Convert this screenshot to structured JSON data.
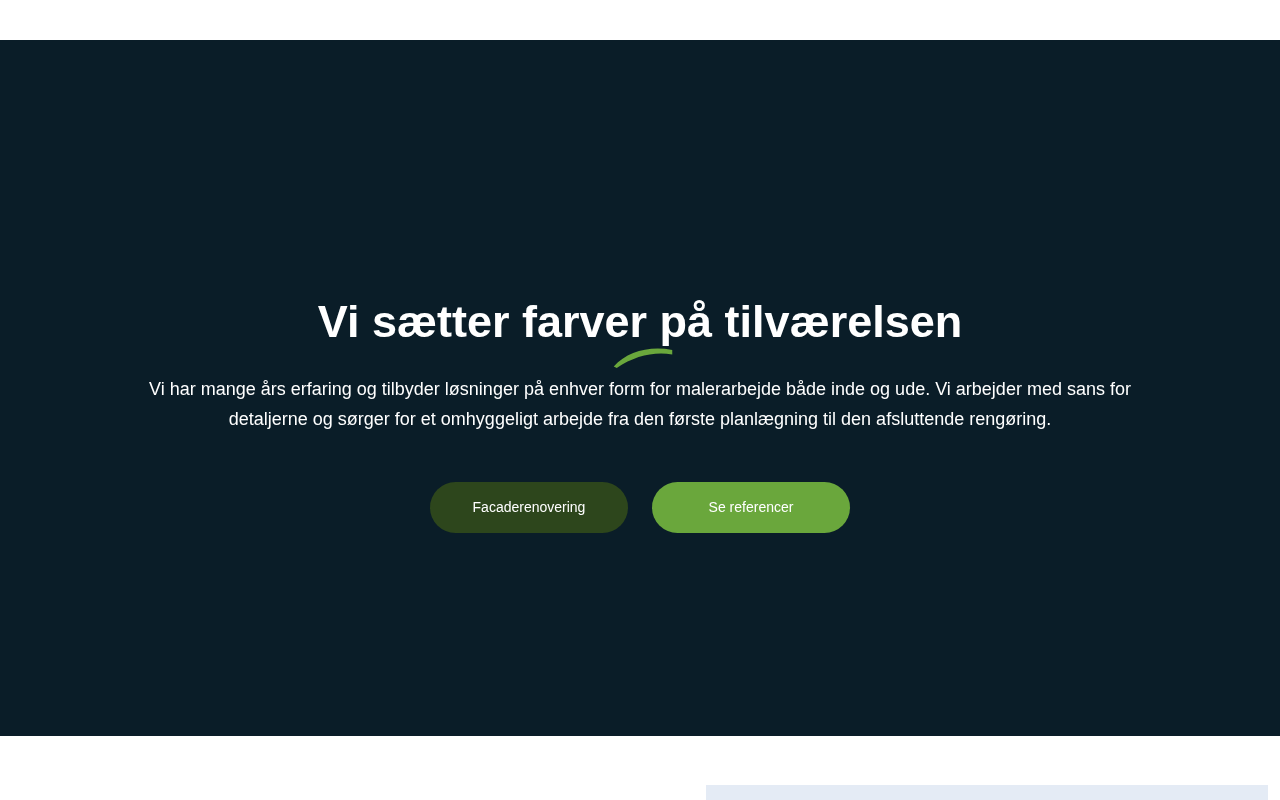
{
  "hero": {
    "title": "Vi sætter farver på tilværelsen",
    "text": "Vi har mange års erfaring og tilbyder løsninger på enhver form for malerarbejde både inde og ude. Vi arbejder med sans for detaljerne og sørger for et omhyggeligt arbejde fra den første planlægning til den afsluttende rengøring.",
    "buttons": [
      {
        "label": "Facaderenovering",
        "kind": "dark"
      },
      {
        "label": "Se referencer",
        "kind": "primary"
      }
    ]
  }
}
